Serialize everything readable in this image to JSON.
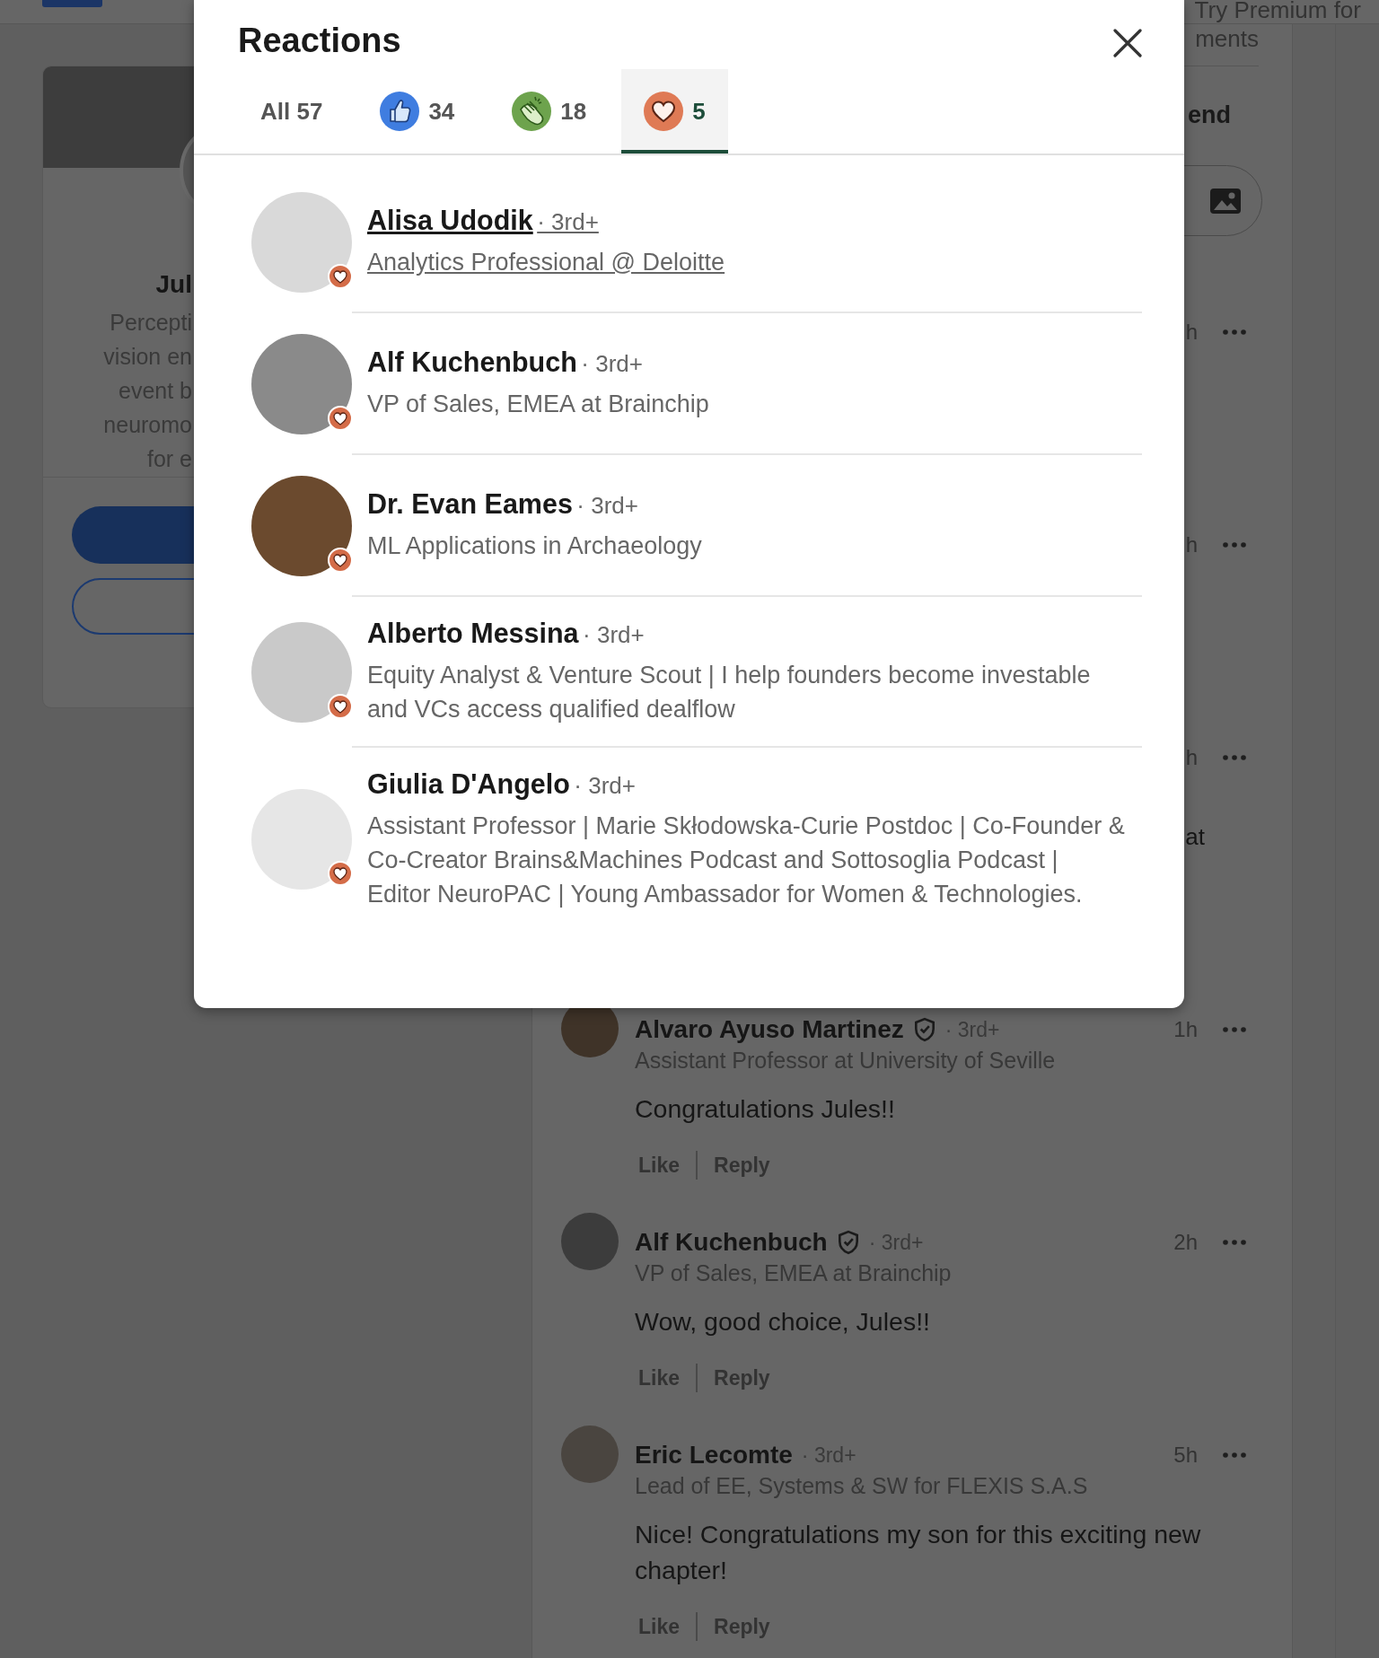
{
  "top_bar": {
    "premium_link": "Try Premium for"
  },
  "profile_card": {
    "name": "Jul",
    "bio_lines": [
      "Percepti",
      "vision en",
      "event b",
      "neuromo",
      "for e"
    ]
  },
  "comments_panel": {
    "heading": "ments",
    "send_label": "end",
    "hidden_comments": [
      {
        "time": "h"
      },
      {
        "time": "h"
      },
      {
        "time": "h",
        "text_tail": "at"
      }
    ],
    "comments": [
      {
        "name": "Alvaro Ayuso Martinez",
        "verified": true,
        "degree": "· 3rd+",
        "time": "1h",
        "headline": "Assistant Professor at University of Seville",
        "text": "Congratulations Jules!!",
        "actions": [
          "Like",
          "Reply"
        ]
      },
      {
        "name": "Alf Kuchenbuch",
        "verified": true,
        "degree": "· 3rd+",
        "time": "2h",
        "headline": "VP of Sales, EMEA at Brainchip",
        "text": "Wow, good choice, Jules!!",
        "actions": [
          "Like",
          "Reply"
        ]
      },
      {
        "name": "Eric Lecomte",
        "verified": false,
        "degree": "· 3rd+",
        "time": "5h",
        "headline": "Lead of EE, Systems & SW for FLEXIS S.A.S",
        "text": "Nice! Congratulations my son for this exciting new chapter!",
        "actions": [
          "Like",
          "Reply"
        ]
      }
    ]
  },
  "reactions_dialog": {
    "title": "Reactions",
    "tabs": [
      {
        "kind": "all",
        "label": "All 57",
        "selected": false
      },
      {
        "kind": "like",
        "label": "34",
        "selected": false
      },
      {
        "kind": "celebrate",
        "label": "18",
        "selected": false
      },
      {
        "kind": "love",
        "label": "5",
        "selected": true
      }
    ],
    "people": [
      {
        "name": "Alisa Udodik",
        "degree": "· 3rd+",
        "headline": "Analytics Professional @ Deloitte",
        "hovered": true
      },
      {
        "name": "Alf Kuchenbuch",
        "degree": "· 3rd+",
        "headline": "VP of Sales, EMEA at Brainchip",
        "hovered": false
      },
      {
        "name": "Dr. Evan Eames",
        "degree": "· 3rd+",
        "headline": "ML Applications in Archaeology",
        "hovered": false
      },
      {
        "name": "Alberto Messina",
        "degree": "· 3rd+",
        "headline": "Equity Analyst & Venture Scout | I help founders become investable and VCs access qualified dealflow",
        "hovered": false
      },
      {
        "name": "Giulia D'Angelo",
        "degree": "· 3rd+",
        "headline": "Assistant Professor | Marie Skłodowska-Curie Postdoc | Co-Founder & Co-Creator Brains&Machines Podcast and Sottosoglia Podcast | Editor NeuroPAC | Young Ambassador for Women & Technologies.",
        "hovered": false
      }
    ]
  }
}
